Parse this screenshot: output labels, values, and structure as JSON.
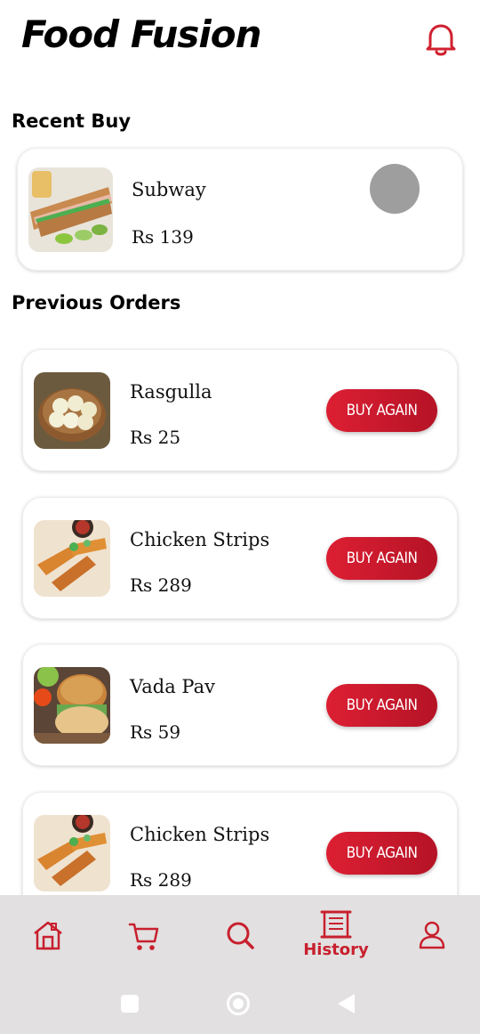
{
  "header": {
    "title": "Food Fusion",
    "notification_icon": "bell-icon"
  },
  "recent": {
    "title": "Recent Buy",
    "item": {
      "name": "Subway",
      "price": "Rs 139"
    }
  },
  "previous": {
    "title": "Previous Orders",
    "orders": [
      {
        "name": "Rasgulla",
        "price": "Rs 25",
        "button": "BUY AGAIN"
      },
      {
        "name": "Chicken Strips",
        "price": "Rs 289",
        "button": "BUY AGAIN"
      },
      {
        "name": "Vada Pav",
        "price": "Rs 59",
        "button": "BUY AGAIN"
      },
      {
        "name": "Chicken Strips",
        "price": "Rs 289",
        "button": "BUY AGAIN"
      }
    ]
  },
  "nav": {
    "items": [
      {
        "icon": "home-icon"
      },
      {
        "icon": "cart-icon"
      },
      {
        "icon": "search-icon"
      },
      {
        "icon": "history-icon",
        "label": "History"
      },
      {
        "icon": "profile-icon"
      }
    ],
    "active_color": "#c8202e"
  },
  "colors": {
    "accent": "#d31c30",
    "nav_bg": "#e2e0e0"
  }
}
